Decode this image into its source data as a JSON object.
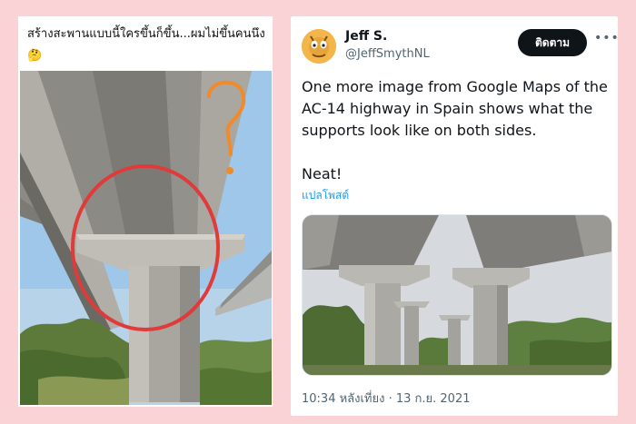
{
  "left_post": {
    "caption": "สร้างสะพานแบบนี้ใครขึ้นก็ขึ้น...ผมไม่ขึ้นคนนึง🤔"
  },
  "tweet": {
    "author_name": "Jeff S.",
    "author_handle": "@JeffSmythNL",
    "follow_label": "ติดตาม",
    "more_icon": "•••",
    "text": "One more image from Google Maps of the AC-14 highway in Spain shows what the supports look like on both sides.\n\nNeat!",
    "translate_label": "แปลโพสต์",
    "timestamp": "10:34 หลังเที่ยง · 13 ก.ย. 2021"
  },
  "colors": {
    "background": "#f9d3d6",
    "follow_button": "#0f1419",
    "link": "#1d9bf0",
    "annotation_circle": "#e03a3a",
    "annotation_question": "#f08a2a"
  }
}
